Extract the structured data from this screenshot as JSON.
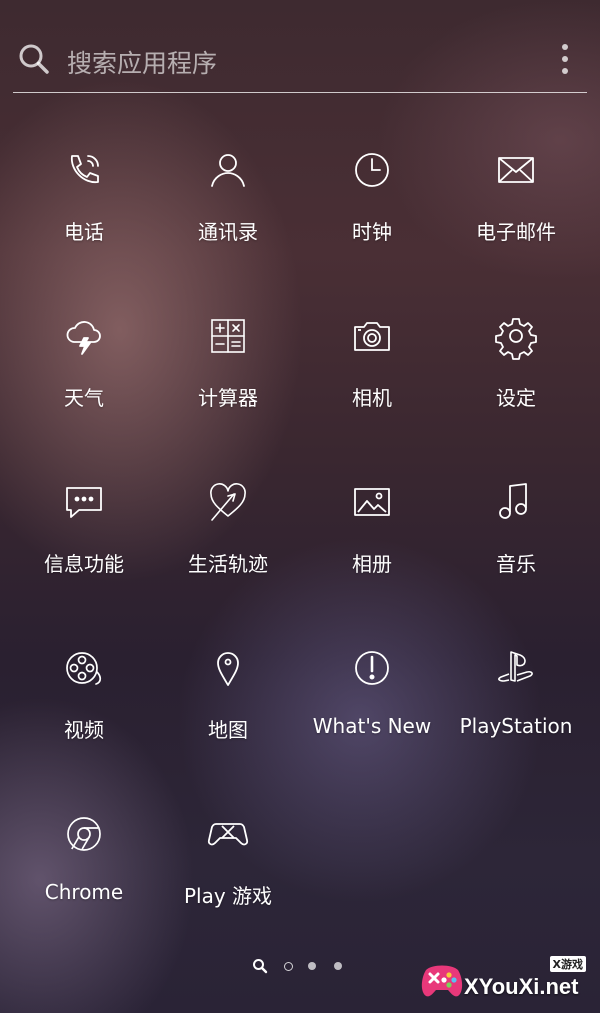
{
  "search": {
    "placeholder": "搜索应用程序",
    "icon": "search-icon",
    "menu_icon": "more-vertical-icon"
  },
  "apps": [
    {
      "label": "电话",
      "icon": "phone-icon"
    },
    {
      "label": "通讯录",
      "icon": "contacts-icon"
    },
    {
      "label": "时钟",
      "icon": "clock-icon"
    },
    {
      "label": "电子邮件",
      "icon": "mail-icon"
    },
    {
      "label": "天气",
      "icon": "weather-icon"
    },
    {
      "label": "计算器",
      "icon": "calculator-icon"
    },
    {
      "label": "相机",
      "icon": "camera-icon"
    },
    {
      "label": "设定",
      "icon": "settings-gear-icon"
    },
    {
      "label": "信息功能",
      "icon": "message-icon"
    },
    {
      "label": "生活轨迹",
      "icon": "lifelog-icon"
    },
    {
      "label": "相册",
      "icon": "album-icon"
    },
    {
      "label": "音乐",
      "icon": "music-icon"
    },
    {
      "label": "视频",
      "icon": "video-icon"
    },
    {
      "label": "地图",
      "icon": "map-pin-icon"
    },
    {
      "label": "What's New",
      "icon": "whats-new-icon"
    },
    {
      "label": "PlayStation",
      "icon": "playstation-icon"
    },
    {
      "label": "Chrome",
      "icon": "chrome-icon"
    },
    {
      "label": "Play 游戏",
      "icon": "play-games-icon"
    }
  ],
  "pager": {
    "pages": 3,
    "current": 0,
    "search_icon": "pager-search-icon"
  },
  "watermark": {
    "brand": "XYouXi.net",
    "tag": "X游戏"
  },
  "colors": {
    "text": "#ffffff",
    "background": "#3a2730"
  }
}
